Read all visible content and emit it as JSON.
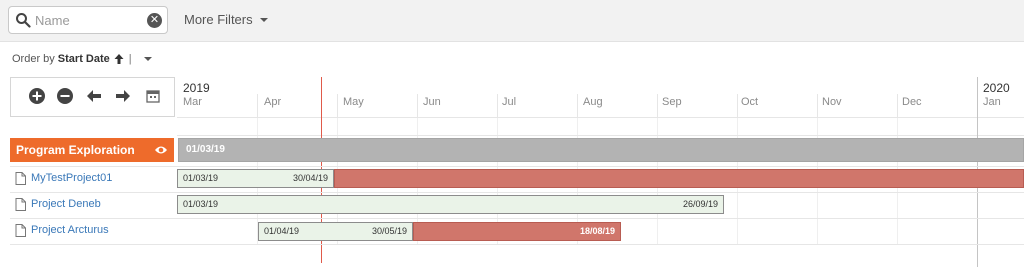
{
  "filters": {
    "search_placeholder": "Name",
    "more_filters_label": "More Filters"
  },
  "order": {
    "prefix": "Order by",
    "field": "Start Date",
    "separator": "|"
  },
  "timeline": {
    "years": [
      "2019",
      "2020"
    ],
    "months": [
      "Mar",
      "Apr",
      "May",
      "Jun",
      "Jul",
      "Aug",
      "Sep",
      "Oct",
      "Nov",
      "Dec",
      "Jan"
    ]
  },
  "group": {
    "label": "Program Exploration",
    "start": "01/03/19"
  },
  "projects": [
    {
      "name": "MyTestProject01",
      "plan_start": "01/03/19",
      "plan_end": "30/04/19",
      "actual_end": ""
    },
    {
      "name": "Project Deneb",
      "plan_start": "01/03/19",
      "plan_end": "26/09/19",
      "actual_end": ""
    },
    {
      "name": "Project Arcturus",
      "plan_start": "01/04/19",
      "plan_end": "30/05/19",
      "actual_end": "18/08/19"
    }
  ],
  "colors": {
    "accent": "#ee6b2b",
    "link": "#3a78b8",
    "today_line": "#e05a4a",
    "actual_bar": "#d0766b",
    "planned_bar": "#eaf3e8",
    "group_bar": "#b3b3b3"
  },
  "icons": {
    "search": "search-icon",
    "clear": "clear-icon",
    "zoom_in": "zoom-in-icon",
    "zoom_out": "zoom-out-icon",
    "back": "arrow-left-icon",
    "forward": "arrow-right-icon",
    "today": "calendar-icon",
    "visibility": "eye-icon",
    "project": "document-icon"
  }
}
